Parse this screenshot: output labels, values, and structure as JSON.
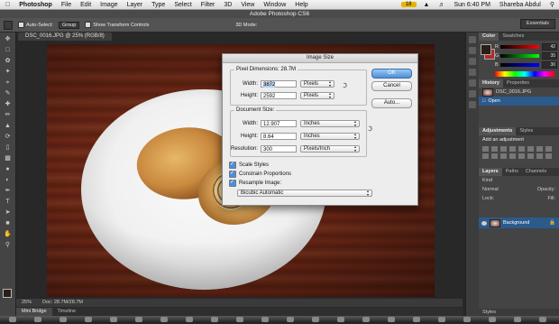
{
  "menubar": {
    "apple": "",
    "app": "Photoshop",
    "items": [
      "File",
      "Edit",
      "Image",
      "Layer",
      "Type",
      "Select",
      "Filter",
      "3D",
      "View",
      "Window",
      "Help"
    ],
    "notification_count": "18",
    "clock": "Sun 6:40 PM",
    "user": "Shareba Abdul"
  },
  "window": {
    "title": "Adobe Photoshop CS6",
    "workspace": "Essentials",
    "document_tab": "DSC_0016.JPG @ 25% (RGB/8)"
  },
  "options_bar": {
    "auto_select": "Auto-Select:",
    "auto_select_value": "Group",
    "show_transform": "Show Transform Controls",
    "mode_3d": "3D Mode:"
  },
  "status": {
    "zoom": "25%",
    "doc": "Doc: 28.7M/28.7M"
  },
  "bottom_tabs": [
    "Mini Bridge",
    "Timeline"
  ],
  "color_panel": {
    "tabs": [
      "Color",
      "Swatches"
    ],
    "channels": [
      {
        "label": "R",
        "value": "42",
        "color": "#d33"
      },
      {
        "label": "G",
        "value": "35",
        "color": "#3c3"
      },
      {
        "label": "B",
        "value": "30",
        "color": "#36d"
      }
    ]
  },
  "history_panel": {
    "tabs": [
      "History",
      "Properties"
    ],
    "snapshot": "DSC_0016.JPG",
    "state": "Open"
  },
  "adjustments_panel": {
    "tabs": [
      "Adjustments",
      "Styles"
    ],
    "hint": "Add an adjustment"
  },
  "layers_panel": {
    "tabs": [
      "Layers",
      "Paths",
      "Channels"
    ],
    "kind": "Kind",
    "blend": "Normal",
    "opacity": "Opacity:",
    "lock": "Lock:",
    "fill": "Fill:",
    "layer_name": "Background"
  },
  "styles_footer": "Styles",
  "dialog": {
    "title": "Image Size",
    "pixel_dimensions": "Pixel Dimensions:  28.7M",
    "width_label": "Width:",
    "width_value": "3872",
    "width_unit": "Pixels",
    "height_label": "Height:",
    "height_value": "2592",
    "height_unit": "Pixels",
    "document_size": "Document Size:",
    "doc_width_label": "Width:",
    "doc_width_value": "12.907",
    "doc_width_unit": "Inches",
    "doc_height_label": "Height:",
    "doc_height_value": "8.64",
    "doc_height_unit": "Inches",
    "resolution_label": "Resolution:",
    "resolution_value": "300",
    "resolution_unit": "Pixels/Inch",
    "scale_styles": "Scale Styles",
    "constrain": "Constrain Proportions",
    "resample": "Resample Image:",
    "resample_method": "Bicubic Automatic",
    "ok": "OK",
    "cancel": "Cancel",
    "auto": "Auto..."
  }
}
